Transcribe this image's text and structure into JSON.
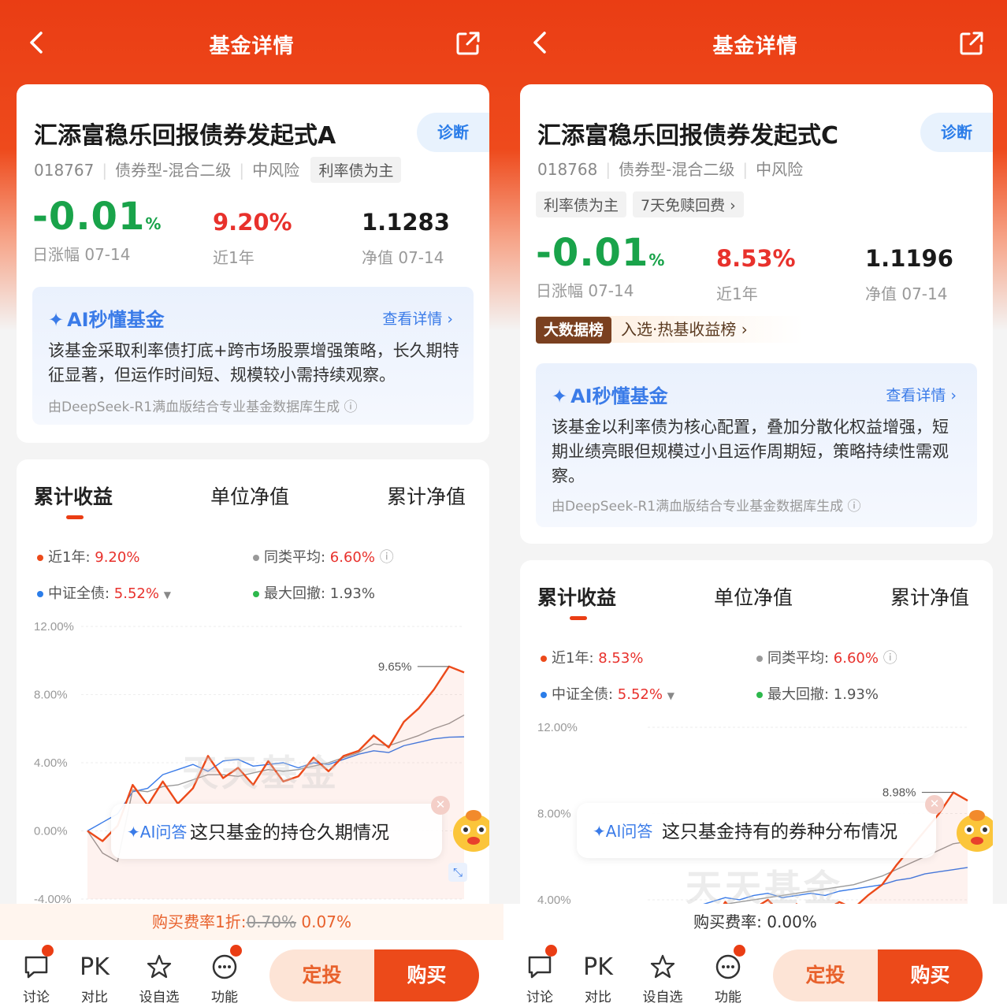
{
  "panels": [
    {
      "header": {
        "title": "基金详情"
      },
      "fund": {
        "name": "汇添富稳乐回报债券发起式A",
        "diagnose": "诊断",
        "code": "018767",
        "type": "债券型-混合二级",
        "risk": "中风险",
        "tag": "利率债为主",
        "daily_change": "-0.01",
        "daily_unit": "%",
        "daily_label": "日涨幅 07-14",
        "year_return": "9.20%",
        "year_label": "近1年",
        "nav": "1.1283",
        "nav_label": "净值 07-14"
      },
      "ai": {
        "title": "AI秒懂基金",
        "more": "查看详情 ›",
        "text": "该基金采取利率债打底+跨市场股票增强策略，长久期特征显著，但运作时间短、规模较小需持续观察。",
        "source": "由DeepSeek-R1满血版结合专业基金数据库生成 ⓘ"
      },
      "tabs": [
        "累计收益",
        "单位净值",
        "累计净值"
      ],
      "legend": {
        "year_label": "近1年: ",
        "year_value": "9.20%",
        "peer_label": "同类平均: ",
        "peer_value": "6.60%",
        "index_label": "中证全债: ",
        "index_value": "5.52%",
        "drawdown_label": "最大回撤: ",
        "drawdown_value": "1.93%"
      },
      "chart_data": {
        "type": "line",
        "yticks": [
          "12.00%",
          "8.00%",
          "4.00%",
          "0.00%",
          "-4.00%"
        ],
        "ylim": [
          -4,
          12
        ],
        "peak_label": "9.65%",
        "series": [
          {
            "name": "近1年",
            "color": "#ec4a1a",
            "values": [
              0,
              -0.6,
              0.3,
              2.7,
              1.5,
              2.9,
              1.6,
              2.5,
              4.4,
              3.1,
              3.7,
              2.7,
              4.1,
              2.9,
              3.2,
              4.3,
              3.5,
              4.4,
              4.7,
              5.6,
              4.9,
              6.4,
              7.2,
              8.3,
              9.65,
              9.3
            ]
          },
          {
            "name": "同类平均",
            "color": "#999999",
            "values": [
              0,
              -1.3,
              -1.8,
              2.4,
              2.3,
              2.6,
              2.7,
              3.0,
              3.3,
              3.3,
              3.2,
              3.4,
              3.6,
              3.5,
              3.6,
              3.8,
              4.0,
              4.3,
              4.6,
              5.1,
              5.0,
              5.3,
              5.6,
              6.0,
              6.3,
              6.8
            ]
          },
          {
            "name": "中证全债",
            "color": "#3a7be8",
            "values": [
              0,
              0.5,
              1.0,
              2.3,
              2.5,
              3.3,
              3.6,
              3.9,
              3.5,
              4.1,
              4.2,
              3.8,
              3.9,
              4.0,
              3.7,
              4.0,
              3.9,
              4.2,
              4.5,
              4.7,
              4.6,
              5.0,
              5.2,
              5.4,
              5.5,
              5.52
            ]
          }
        ]
      },
      "qa": {
        "badge": "AI问答",
        "question": "这只基金的持仓久期情况"
      },
      "fee": {
        "label": "购买费率1折:",
        "original": "0.70%",
        "current": "0.07%"
      },
      "bottom": {
        "discuss": "讨论",
        "pk": "PK",
        "compare": "对比",
        "watch": "设自选",
        "func": "功能",
        "plan": "定投",
        "buy": "购买"
      }
    },
    {
      "header": {
        "title": "基金详情"
      },
      "fund": {
        "name": "汇添富稳乐回报债券发起式C",
        "diagnose": "诊断",
        "code": "018768",
        "type": "债券型-混合二级",
        "risk": "中风险",
        "tag": "利率债为主",
        "tag2": "7天免赎回费 ›",
        "daily_change": "-0.01",
        "daily_unit": "%",
        "daily_label": "日涨幅 07-14",
        "year_return": "8.53%",
        "year_label": "近1年",
        "nav": "1.1196",
        "nav_label": "净值 07-14"
      },
      "rank": {
        "badge": "大数据榜",
        "text": "入选·热基收益榜 ›"
      },
      "ai": {
        "title": "AI秒懂基金",
        "more": "查看详情 ›",
        "text": "该基金以利率债为核心配置，叠加分散化权益增强，短期业绩亮眼但规模过小且运作周期短，策略持续性需观察。",
        "source": "由DeepSeek-R1满血版结合专业基金数据库生成 ⓘ"
      },
      "tabs": [
        "累计收益",
        "单位净值",
        "累计净值"
      ],
      "legend": {
        "year_label": "近1年: ",
        "year_value": "8.53%",
        "peer_label": "同类平均: ",
        "peer_value": "6.60%",
        "index_label": "中证全债: ",
        "index_value": "5.52%",
        "drawdown_label": "最大回撤: ",
        "drawdown_value": "1.93%"
      },
      "chart_data": {
        "type": "line",
        "yticks": [
          "12.00%",
          "8.00%",
          "4.00%"
        ],
        "ylim": [
          2.5,
          12
        ],
        "peak_label": "8.98%",
        "series": [
          {
            "name": "近1年",
            "color": "#ec4a1a",
            "values": [
              2.5,
              2.9,
              2.6,
              3.6,
              2.9,
              3.9,
              3.1,
              3.6,
              4.0,
              3.3,
              3.8,
              3.2,
              3.5,
              3.9,
              3.6,
              4.2,
              4.7,
              5.6,
              6.4,
              7.2,
              8.0,
              8.98,
              8.6
            ]
          },
          {
            "name": "同类平均",
            "color": "#999999",
            "values": [
              2.5,
              2.8,
              3.1,
              3.4,
              3.6,
              3.8,
              3.9,
              4.0,
              4.1,
              4.2,
              4.3,
              4.4,
              4.5,
              4.6,
              4.7,
              4.9,
              5.1,
              5.4,
              5.7,
              6.0,
              6.3,
              6.6,
              6.7
            ]
          },
          {
            "name": "中证全债",
            "color": "#3a7be8",
            "values": [
              2.5,
              3.0,
              3.3,
              3.7,
              3.9,
              4.1,
              4.0,
              4.2,
              4.3,
              4.1,
              4.2,
              4.3,
              4.2,
              4.4,
              4.5,
              4.6,
              4.7,
              4.9,
              5.0,
              5.2,
              5.3,
              5.4,
              5.5
            ]
          }
        ]
      },
      "qa": {
        "badge": "AI问答",
        "question": "这只基金持有的券种分布情况"
      },
      "fee": {
        "label": "购买费率: 0.00%"
      },
      "bottom": {
        "discuss": "讨论",
        "pk": "PK",
        "compare": "对比",
        "watch": "设自选",
        "func": "功能",
        "plan": "定投",
        "buy": "购买"
      }
    }
  ]
}
